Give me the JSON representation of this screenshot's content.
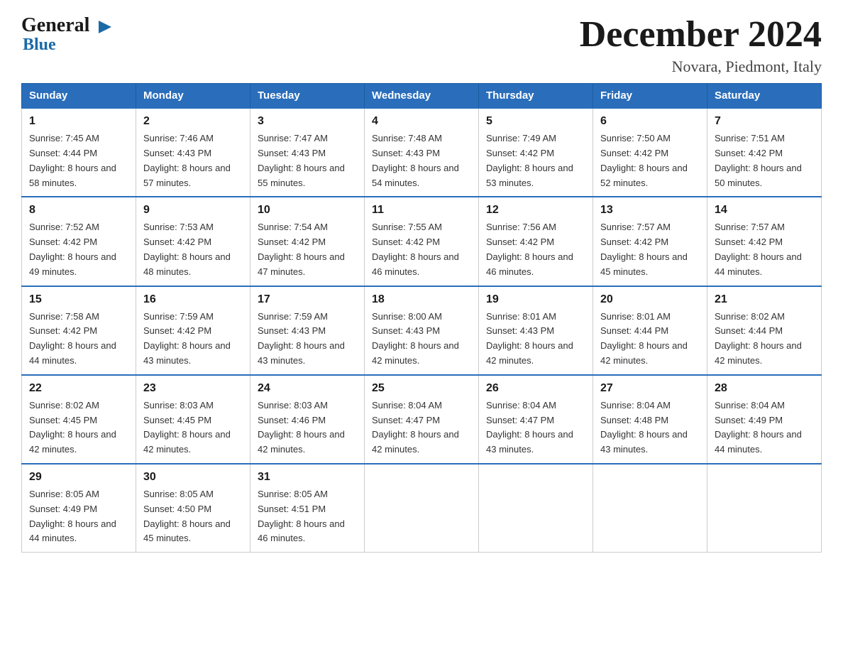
{
  "logo": {
    "general": "General",
    "blue": "Blue"
  },
  "title": "December 2024",
  "subtitle": "Novara, Piedmont, Italy",
  "days_of_week": [
    "Sunday",
    "Monday",
    "Tuesday",
    "Wednesday",
    "Thursday",
    "Friday",
    "Saturday"
  ],
  "weeks": [
    [
      {
        "day": "1",
        "sunrise": "7:45 AM",
        "sunset": "4:44 PM",
        "daylight": "8 hours and 58 minutes."
      },
      {
        "day": "2",
        "sunrise": "7:46 AM",
        "sunset": "4:43 PM",
        "daylight": "8 hours and 57 minutes."
      },
      {
        "day": "3",
        "sunrise": "7:47 AM",
        "sunset": "4:43 PM",
        "daylight": "8 hours and 55 minutes."
      },
      {
        "day": "4",
        "sunrise": "7:48 AM",
        "sunset": "4:43 PM",
        "daylight": "8 hours and 54 minutes."
      },
      {
        "day": "5",
        "sunrise": "7:49 AM",
        "sunset": "4:42 PM",
        "daylight": "8 hours and 53 minutes."
      },
      {
        "day": "6",
        "sunrise": "7:50 AM",
        "sunset": "4:42 PM",
        "daylight": "8 hours and 52 minutes."
      },
      {
        "day": "7",
        "sunrise": "7:51 AM",
        "sunset": "4:42 PM",
        "daylight": "8 hours and 50 minutes."
      }
    ],
    [
      {
        "day": "8",
        "sunrise": "7:52 AM",
        "sunset": "4:42 PM",
        "daylight": "8 hours and 49 minutes."
      },
      {
        "day": "9",
        "sunrise": "7:53 AM",
        "sunset": "4:42 PM",
        "daylight": "8 hours and 48 minutes."
      },
      {
        "day": "10",
        "sunrise": "7:54 AM",
        "sunset": "4:42 PM",
        "daylight": "8 hours and 47 minutes."
      },
      {
        "day": "11",
        "sunrise": "7:55 AM",
        "sunset": "4:42 PM",
        "daylight": "8 hours and 46 minutes."
      },
      {
        "day": "12",
        "sunrise": "7:56 AM",
        "sunset": "4:42 PM",
        "daylight": "8 hours and 46 minutes."
      },
      {
        "day": "13",
        "sunrise": "7:57 AM",
        "sunset": "4:42 PM",
        "daylight": "8 hours and 45 minutes."
      },
      {
        "day": "14",
        "sunrise": "7:57 AM",
        "sunset": "4:42 PM",
        "daylight": "8 hours and 44 minutes."
      }
    ],
    [
      {
        "day": "15",
        "sunrise": "7:58 AM",
        "sunset": "4:42 PM",
        "daylight": "8 hours and 44 minutes."
      },
      {
        "day": "16",
        "sunrise": "7:59 AM",
        "sunset": "4:42 PM",
        "daylight": "8 hours and 43 minutes."
      },
      {
        "day": "17",
        "sunrise": "7:59 AM",
        "sunset": "4:43 PM",
        "daylight": "8 hours and 43 minutes."
      },
      {
        "day": "18",
        "sunrise": "8:00 AM",
        "sunset": "4:43 PM",
        "daylight": "8 hours and 42 minutes."
      },
      {
        "day": "19",
        "sunrise": "8:01 AM",
        "sunset": "4:43 PM",
        "daylight": "8 hours and 42 minutes."
      },
      {
        "day": "20",
        "sunrise": "8:01 AM",
        "sunset": "4:44 PM",
        "daylight": "8 hours and 42 minutes."
      },
      {
        "day": "21",
        "sunrise": "8:02 AM",
        "sunset": "4:44 PM",
        "daylight": "8 hours and 42 minutes."
      }
    ],
    [
      {
        "day": "22",
        "sunrise": "8:02 AM",
        "sunset": "4:45 PM",
        "daylight": "8 hours and 42 minutes."
      },
      {
        "day": "23",
        "sunrise": "8:03 AM",
        "sunset": "4:45 PM",
        "daylight": "8 hours and 42 minutes."
      },
      {
        "day": "24",
        "sunrise": "8:03 AM",
        "sunset": "4:46 PM",
        "daylight": "8 hours and 42 minutes."
      },
      {
        "day": "25",
        "sunrise": "8:04 AM",
        "sunset": "4:47 PM",
        "daylight": "8 hours and 42 minutes."
      },
      {
        "day": "26",
        "sunrise": "8:04 AM",
        "sunset": "4:47 PM",
        "daylight": "8 hours and 43 minutes."
      },
      {
        "day": "27",
        "sunrise": "8:04 AM",
        "sunset": "4:48 PM",
        "daylight": "8 hours and 43 minutes."
      },
      {
        "day": "28",
        "sunrise": "8:04 AM",
        "sunset": "4:49 PM",
        "daylight": "8 hours and 44 minutes."
      }
    ],
    [
      {
        "day": "29",
        "sunrise": "8:05 AM",
        "sunset": "4:49 PM",
        "daylight": "8 hours and 44 minutes."
      },
      {
        "day": "30",
        "sunrise": "8:05 AM",
        "sunset": "4:50 PM",
        "daylight": "8 hours and 45 minutes."
      },
      {
        "day": "31",
        "sunrise": "8:05 AM",
        "sunset": "4:51 PM",
        "daylight": "8 hours and 46 minutes."
      },
      null,
      null,
      null,
      null
    ]
  ]
}
